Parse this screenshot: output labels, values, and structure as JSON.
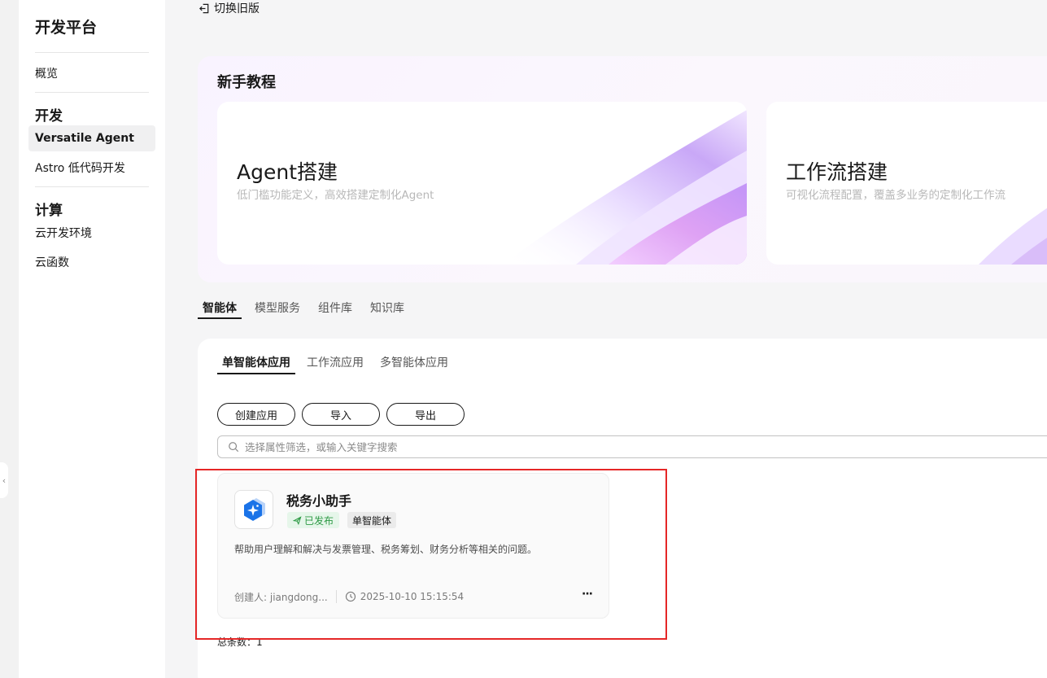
{
  "sidebar": {
    "brand": "开发平台",
    "overview": "概览",
    "sections": [
      {
        "title": "开发",
        "items": [
          "Versatile Agent",
          "Astro 低代码开发"
        ]
      },
      {
        "title": "计算",
        "items": [
          "云开发环境",
          "云函数"
        ]
      }
    ]
  },
  "header": {
    "switch_old": "切换旧版"
  },
  "tutorial": {
    "title": "新手教程",
    "cards": [
      {
        "title": "Agent搭建",
        "subtitle": "低门槛功能定义，高效搭建定制化Agent"
      },
      {
        "title": "工作流搭建",
        "subtitle": "可视化流程配置，覆盖多业务的定制化工作流"
      }
    ]
  },
  "main_tabs": [
    "智能体",
    "模型服务",
    "组件库",
    "知识库"
  ],
  "sub_tabs": [
    "单智能体应用",
    "工作流应用",
    "多智能体应用"
  ],
  "buttons": {
    "create": "创建应用",
    "import": "导入",
    "export": "导出"
  },
  "search": {
    "placeholder": "选择属性筛选，或输入关键字搜索"
  },
  "app_card": {
    "name": "税务小助手",
    "status": "已发布",
    "type": "单智能体",
    "description": "帮助用户理解和解决与发票管理、税务筹划、财务分析等相关的问题。",
    "creator": "创建人: jiangdong...",
    "timestamp": "2025-10-10 15:15:54",
    "more": "···"
  },
  "total": "总条数：1",
  "colors": {
    "accent": "#191919",
    "published": "#2e9a45",
    "app_icon": "#1a73e8",
    "highlight": "#e52727"
  },
  "icons": [
    "switch-old-icon",
    "search-icon",
    "app-icon",
    "send-icon",
    "clock-icon",
    "more-icon",
    "chevron-left-icon"
  ]
}
